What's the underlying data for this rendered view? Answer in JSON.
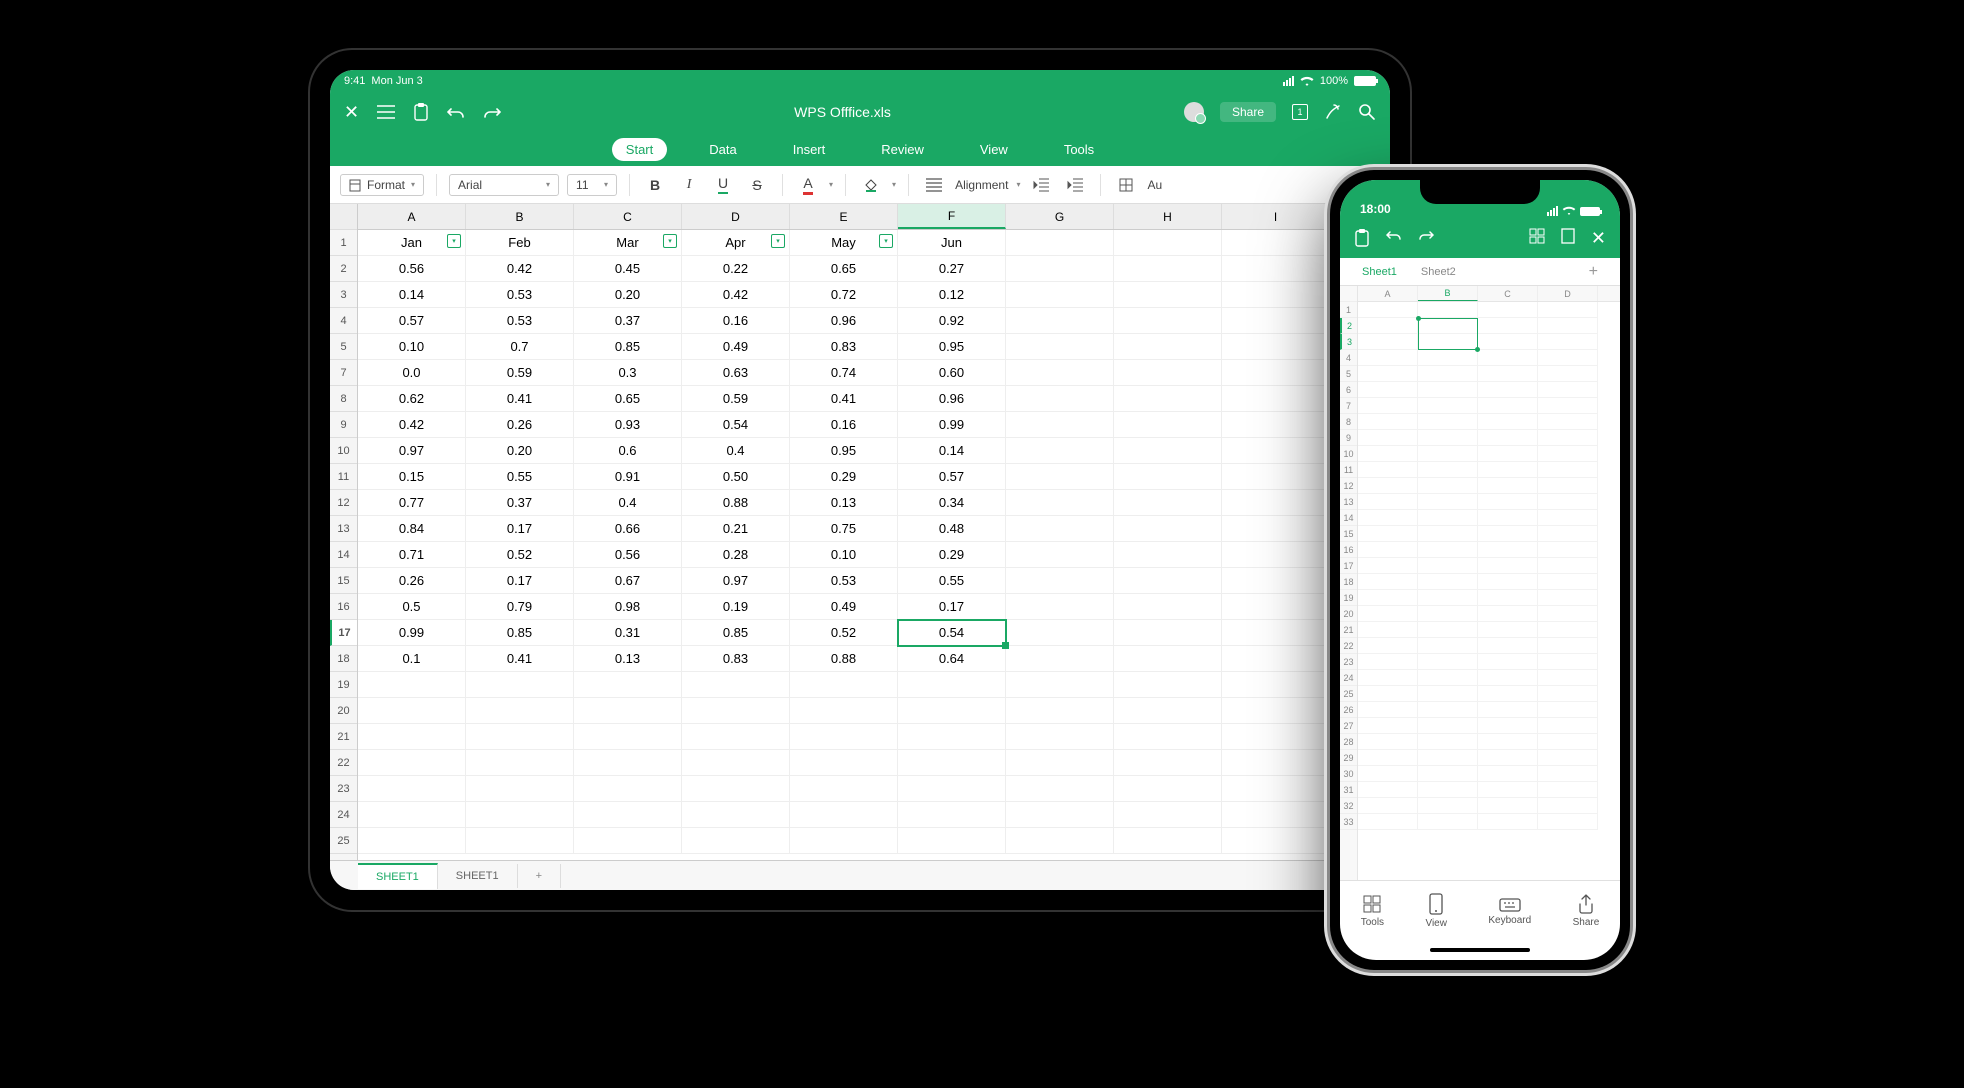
{
  "tablet": {
    "status": {
      "time": "9:41",
      "date": "Mon Jun 3",
      "battery": "100%"
    },
    "title": "WPS Offfice.xls",
    "share_label": "Share",
    "tabs": [
      "Start",
      "Data",
      "Insert",
      "Review",
      "View",
      "Tools"
    ],
    "toolbar": {
      "format": "Format",
      "font_name": "Arial",
      "font_size": "11",
      "alignment": "Alignment",
      "auto": "Au"
    },
    "columns": [
      "A",
      "B",
      "C",
      "D",
      "E",
      "F",
      "G",
      "H",
      "I"
    ],
    "selected_col": "F",
    "selected_row": 17,
    "month_headers": [
      "Jan",
      "Feb",
      "Mar",
      "Apr",
      "May",
      "Jun"
    ],
    "data": [
      [
        "0.56",
        "0.42",
        "0.45",
        "0.22",
        "0.65",
        "0.27"
      ],
      [
        "0.14",
        "0.53",
        "0.20",
        "0.42",
        "0.72",
        "0.12"
      ],
      [
        "0.57",
        "0.53",
        "0.37",
        "0.16",
        "0.96",
        "0.92"
      ],
      [
        "0.10",
        "0.7",
        "0.85",
        "0.49",
        "0.83",
        "0.95"
      ],
      [
        "0.0",
        "0.59",
        "0.3",
        "0.63",
        "0.74",
        "0.60"
      ],
      [
        "0.62",
        "0.41",
        "0.65",
        "0.59",
        "0.41",
        "0.96"
      ],
      [
        "0.42",
        "0.26",
        "0.93",
        "0.54",
        "0.16",
        "0.99"
      ],
      [
        "0.97",
        "0.20",
        "0.6",
        "0.4",
        "0.95",
        "0.14"
      ],
      [
        "0.15",
        "0.55",
        "0.91",
        "0.50",
        "0.29",
        "0.57"
      ],
      [
        "0.77",
        "0.37",
        "0.4",
        "0.88",
        "0.13",
        "0.34"
      ],
      [
        "0.84",
        "0.17",
        "0.66",
        "0.21",
        "0.75",
        "0.48"
      ],
      [
        "0.71",
        "0.52",
        "0.56",
        "0.28",
        "0.10",
        "0.29"
      ],
      [
        "0.26",
        "0.17",
        "0.67",
        "0.97",
        "0.53",
        "0.55"
      ],
      [
        "0.5",
        "0.79",
        "0.98",
        "0.19",
        "0.49",
        "0.17"
      ],
      [
        "0.99",
        "0.85",
        "0.31",
        "0.85",
        "0.52",
        "0.54"
      ],
      [
        "0.1",
        "0.41",
        "0.13",
        "0.83",
        "0.88",
        "0.64"
      ]
    ],
    "row_display_numbers": [
      1,
      2,
      3,
      4,
      5,
      7,
      8,
      9,
      10,
      11,
      12,
      13,
      14,
      15,
      16,
      17,
      18,
      19,
      20,
      21,
      22,
      23,
      24,
      25
    ],
    "sheet_tabs": [
      "SHEET1",
      "SHEET1"
    ]
  },
  "phone": {
    "time": "18:00",
    "sheet_tabs": [
      "Sheet1",
      "Sheet2"
    ],
    "columns": [
      "A",
      "B",
      "C",
      "D"
    ],
    "bottom": [
      "Tools",
      "View",
      "Keyboard",
      "Share"
    ]
  }
}
